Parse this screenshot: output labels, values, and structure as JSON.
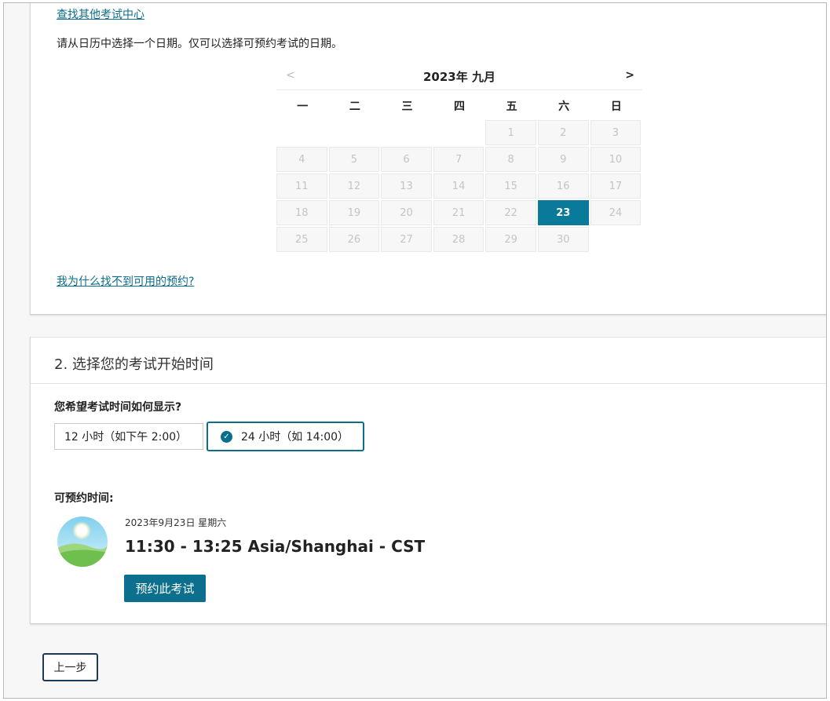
{
  "section1": {
    "find_other_centers": "查找其他考试中心",
    "instruction": "请从日历中选择一个日期。仅可以选择可预约考试的日期。",
    "calendar": {
      "prev": "<",
      "next": ">",
      "month_title": "2023年 九月",
      "weekdays": [
        "一",
        "二",
        "三",
        "四",
        "五",
        "六",
        "日"
      ],
      "leading_blanks": 4,
      "days": [
        "1",
        "2",
        "3",
        "4",
        "5",
        "6",
        "7",
        "8",
        "9",
        "10",
        "11",
        "12",
        "13",
        "14",
        "15",
        "16",
        "17",
        "18",
        "19",
        "20",
        "21",
        "22",
        "23",
        "24",
        "25",
        "26",
        "27",
        "28",
        "29",
        "30"
      ],
      "selected_day": "23",
      "selected_color": "#0a7a9a"
    },
    "why_link": "我为什么找不到可用的预约?"
  },
  "section2": {
    "title": "2. 选择您的考试开始时间",
    "question": "您希望考试时间如何显示?",
    "option_12h": "12 小时（如下午 2:00）",
    "option_24h": "24 小时（如 14:00）",
    "selected_option": "24h",
    "available_label": "可预约时间:",
    "slot": {
      "icon": "daytime-landscape-icon",
      "date": "2023年9月23日 星期六",
      "time": "11:30 - 13:25 Asia/Shanghai - CST",
      "book_button": "预约此考试"
    }
  },
  "footer": {
    "back_button": "上一步"
  },
  "colors": {
    "accent": "#0b6f8d",
    "link": "#0b6e8c"
  }
}
